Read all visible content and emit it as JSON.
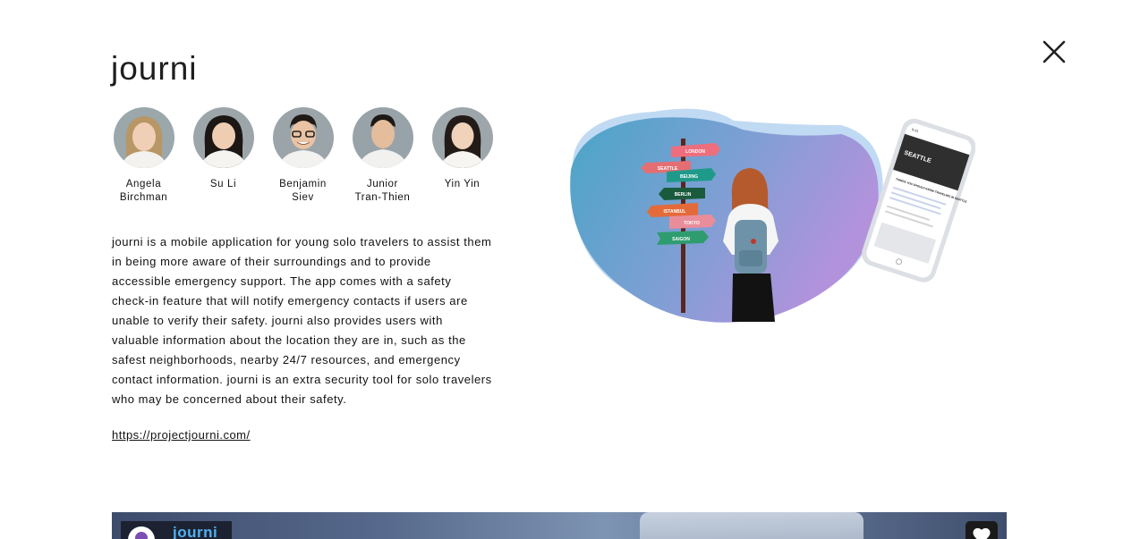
{
  "project": {
    "title": "journi",
    "description": "journi is a mobile application for young solo travelers to assist them in being more aware of their surroundings and to provide accessible emergency support. The app comes with a safety check-in feature that will notify emergency contacts if users are unable to verify their safety. journi also provides users with valuable information about the location they are in, such as the safest neighborhoods, nearby 24/7 resources, and emergency contact information. journi is an extra security tool for solo travelers who may be concerned about their safety.",
    "link": "https://projectjourni.com/"
  },
  "team": [
    {
      "name": "Angela\nBirchman"
    },
    {
      "name": "Su Li"
    },
    {
      "name": "Benjamin\nSiev"
    },
    {
      "name": "Junior\nTran-Thien"
    },
    {
      "name": "Yin Yin"
    }
  ],
  "illustration": {
    "signposts": [
      "LONDON",
      "SEATTLE",
      "BEIJING",
      "BERLIN",
      "ISTANBUL",
      "TOKYO",
      "SAIGON"
    ],
    "phone_time": "9:41",
    "phone_heading": "SEATTLE",
    "phone_subheading": "THINGS YOU SHOULD KNOW TRAVELING IN SEATTLE"
  },
  "video": {
    "channel_name": "journi"
  },
  "icons": {
    "close": "close-icon",
    "like": "heart-icon"
  },
  "colors": {
    "text": "#1a1a1a",
    "blob_blue": "#4da6c9",
    "blob_purple": "#ae8ed9",
    "accent_link": "#4fb0f0"
  }
}
